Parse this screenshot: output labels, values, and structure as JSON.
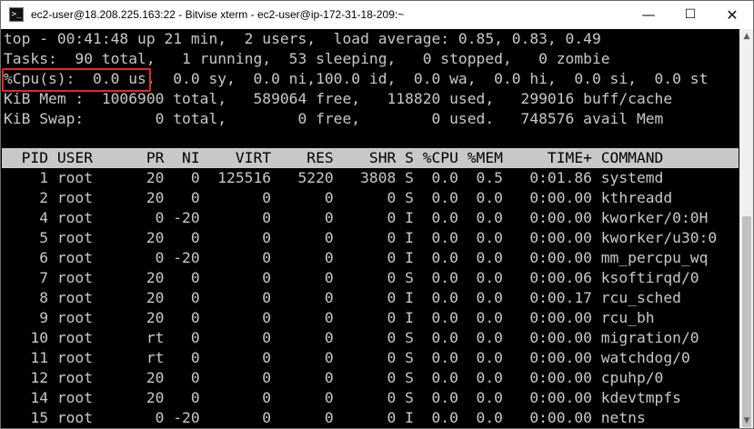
{
  "window": {
    "title": "ec2-user@18.208.225.163:22 - Bitvise xterm - ec2-user@ip-172-31-18-209:~",
    "app_icon": ">_",
    "minimize_glyph": "—",
    "maximize_glyph": "☐",
    "close_glyph": "✕"
  },
  "summary": {
    "line1": "top - 00:41:48 up 21 min,  2 users,  load average: 0.85, 0.83, 0.49",
    "line2": "Tasks:  90 total,   1 running,  53 sleeping,   0 stopped,   0 zombie",
    "line3": "%Cpu(s):  0.0 us,  0.0 sy,  0.0 ni,100.0 id,  0.0 wa,  0.0 hi,  0.0 si,  0.0 st",
    "line4": "KiB Mem :  1006900 total,   589064 free,   118820 used,   299016 buff/cache",
    "line5": "KiB Swap:        0 total,        0 free,        0 used.   748576 avail Mem"
  },
  "process_header": "  PID USER      PR  NI    VIRT    RES    SHR S %CPU %MEM     TIME+ COMMAND",
  "processes": [
    "    1 root      20   0  125516   5220   3808 S  0.0  0.5   0:01.86 systemd",
    "    2 root      20   0       0      0      0 S  0.0  0.0   0:00.00 kthreadd",
    "    4 root       0 -20       0      0      0 I  0.0  0.0   0:00.00 kworker/0:0H",
    "    5 root      20   0       0      0      0 I  0.0  0.0   0:00.00 kworker/u30:0",
    "    6 root       0 -20       0      0      0 I  0.0  0.0   0:00.00 mm_percpu_wq",
    "    7 root      20   0       0      0      0 S  0.0  0.0   0:00.06 ksoftirqd/0",
    "    8 root      20   0       0      0      0 I  0.0  0.0   0:00.17 rcu_sched",
    "    9 root      20   0       0      0      0 I  0.0  0.0   0:00.00 rcu_bh",
    "   10 root      rt   0       0      0      0 S  0.0  0.0   0:00.00 migration/0",
    "   11 root      rt   0       0      0      0 S  0.0  0.0   0:00.00 watchdog/0",
    "   12 root      20   0       0      0      0 S  0.0  0.0   0:00.00 cpuhp/0",
    "   14 root      20   0       0      0      0 S  0.0  0.0   0:00.00 kdevtmpfs",
    "   15 root       0 -20       0      0      0 I  0.0  0.0   0:00.00 netns"
  ],
  "scrollbar": {
    "up_glyph": "▲",
    "down_glyph": "▼"
  },
  "colors": {
    "terminal_fg": "#c8c8c8",
    "terminal_bg": "#000000",
    "header_bar": "#c8c8c8",
    "highlight": "#e0282b"
  }
}
